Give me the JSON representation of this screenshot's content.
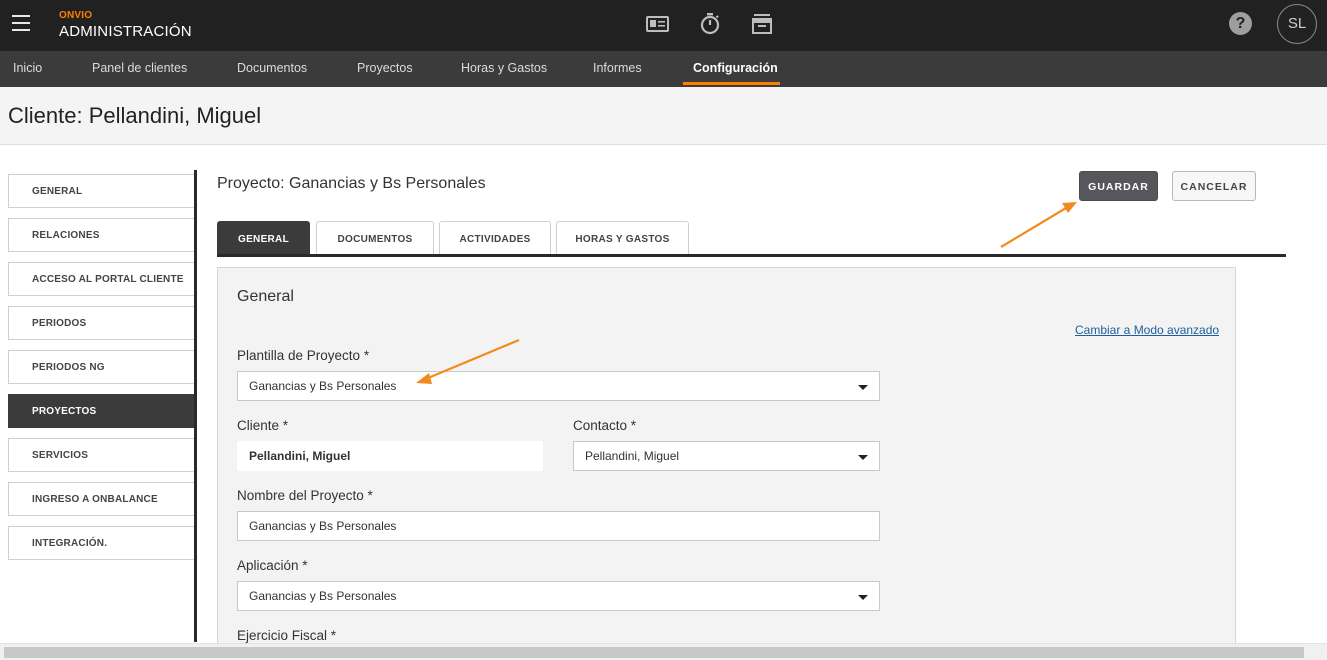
{
  "header": {
    "brand_small": "ONVIO",
    "brand_big": "ADMINISTRACIÓN",
    "avatar_initials": "SL",
    "help_glyph": "?",
    "icons": [
      "id-card-icon",
      "stopwatch-icon",
      "archive-box-icon"
    ]
  },
  "nav": {
    "items": [
      "Inicio",
      "Panel de clientes",
      "Documentos",
      "Proyectos",
      "Horas y Gastos",
      "Informes",
      "Configuración"
    ],
    "active": "Configuración"
  },
  "page": {
    "title": "Cliente: Pellandini, Miguel"
  },
  "sidebar": {
    "items": [
      "GENERAL",
      "RELACIONES",
      "ACCESO AL PORTAL CLIENTE",
      "PERIODOS",
      "PERIODOS NG",
      "PROYECTOS",
      "SERVICIOS",
      "INGRESO A ONBALANCE",
      "INTEGRACIÓN."
    ],
    "active": "PROYECTOS"
  },
  "main": {
    "project_title": "Proyecto: Ganancias y Bs Personales",
    "save_label": "GUARDAR",
    "cancel_label": "CANCELAR",
    "tabs": [
      "GENERAL",
      "DOCUMENTOS",
      "ACTIVIDADES",
      "HORAS Y GASTOS"
    ],
    "active_tab": "GENERAL"
  },
  "form": {
    "section_title": "General",
    "advanced_link": "Cambiar a Modo avanzado",
    "template_label": "Plantilla de Proyecto *",
    "template_value": "Ganancias y Bs Personales",
    "client_label": "Cliente *",
    "client_value": "Pellandini, Miguel",
    "contact_label": "Contacto *",
    "contact_value": "Pellandini, Miguel",
    "name_label": "Nombre del Proyecto *",
    "name_value": "Ganancias y Bs Personales",
    "app_label": "Aplicación *",
    "app_value": "Ganancias y Bs Personales",
    "fiscal_label": "Ejercicio Fiscal *"
  },
  "colors": {
    "accent": "#ff8000",
    "topbar": "#212121",
    "navbar": "#3b3b3b",
    "link": "#1c5f9c"
  }
}
